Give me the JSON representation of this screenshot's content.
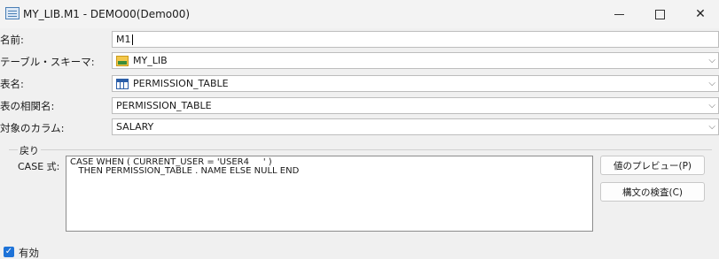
{
  "window": {
    "title": "MY_LIB.M1 - DEMO00(Demo00)",
    "minimize": "—",
    "close": "✕"
  },
  "form": {
    "name_label": "名前:",
    "name_value": "M1",
    "schema_label": "テーブル・スキーマ:",
    "schema_value": "MY_LIB",
    "table_label": "表名:",
    "table_value": "PERMISSION_TABLE",
    "correlation_label": "表の相関名:",
    "correlation_value": "PERMISSION_TABLE",
    "column_label": "対象のカラム:",
    "column_value": "SALARY",
    "dropdown_chevron": "⌵"
  },
  "return_group": {
    "label": "戻り",
    "case_label": "CASE 式:",
    "case_expression": "CASE WHEN ( CURRENT_USER = 'USER4     ' )\n   THEN PERMISSION_TABLE . NAME ELSE NULL END",
    "preview_button": "値のプレビュー(P)",
    "check_button": "構文の検査(C)"
  },
  "enabled": {
    "label": "有効",
    "checked": true,
    "check_mark": "✓"
  },
  "icons": {
    "app": "table-window-icon",
    "schema": "folder-schema-icon",
    "table": "table-icon"
  },
  "colors": {
    "checkbox": "#1e73d8",
    "table_icon": "#2b5ea8",
    "folder_icon": "#f3c74a"
  }
}
